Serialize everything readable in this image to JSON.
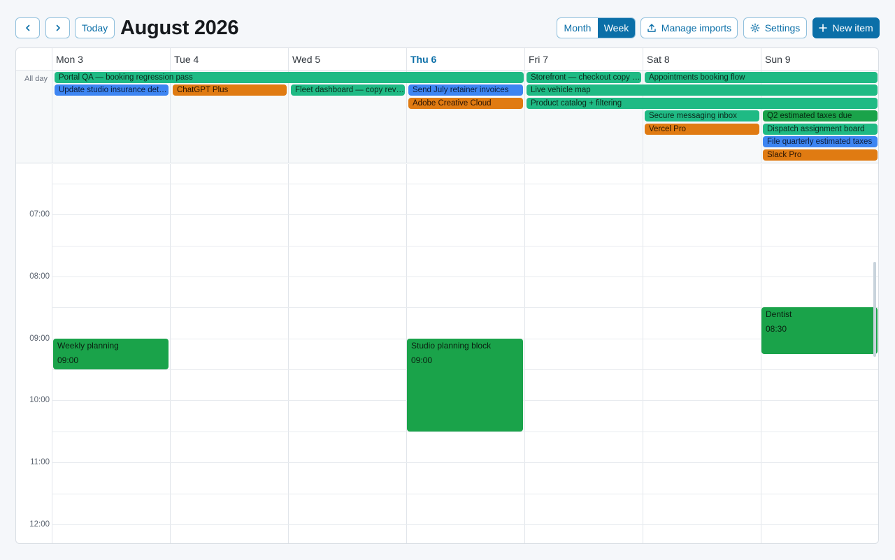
{
  "toolbar": {
    "prev_icon": "chevron-left-icon",
    "next_icon": "chevron-right-icon",
    "today_label": "Today",
    "title": "August 2026",
    "view_month": "Month",
    "view_week": "Week",
    "active_view": "Week",
    "manage_imports_label": "Manage imports",
    "settings_label": "Settings",
    "new_item_label": "New item"
  },
  "days": [
    {
      "label": "Mon 3",
      "today": false
    },
    {
      "label": "Tue 4",
      "today": false
    },
    {
      "label": "Wed 5",
      "today": false
    },
    {
      "label": "Thu 6",
      "today": true
    },
    {
      "label": "Fri 7",
      "today": false
    },
    {
      "label": "Sat 8",
      "today": false
    },
    {
      "label": "Sun 9",
      "today": false
    }
  ],
  "all_day_label": "All day",
  "all_day_events": [
    {
      "title": "Portal QA — booking regression pass",
      "color": "teal"
    },
    {
      "title": "Storefront — checkout copy review",
      "color": "teal"
    },
    {
      "title": "Appointments booking flow",
      "color": "teal"
    },
    {
      "title": "Update studio insurance details",
      "color": "blue"
    },
    {
      "title": "ChatGPT Plus",
      "color": "orange"
    },
    {
      "title": "Fleet dashboard — copy review",
      "color": "teal"
    },
    {
      "title": "Send July retainer invoices",
      "color": "blue"
    },
    {
      "title": "Live vehicle map",
      "color": "teal"
    },
    {
      "title": "Adobe Creative Cloud",
      "color": "orange"
    },
    {
      "title": "Product catalog + filtering",
      "color": "teal"
    },
    {
      "title": "Secure messaging inbox",
      "color": "teal"
    },
    {
      "title": "Q2 estimated taxes due",
      "color": "green"
    },
    {
      "title": "Vercel Pro",
      "color": "orange"
    },
    {
      "title": "Dispatch assignment board",
      "color": "teal"
    },
    {
      "title": "File quarterly estimated taxes",
      "color": "blue"
    },
    {
      "title": "Slack Pro",
      "color": "orange"
    }
  ],
  "time_labels": [
    "07:00",
    "08:00",
    "09:00",
    "10:00",
    "11:00",
    "12:00"
  ],
  "timed_events": [
    {
      "title": "Weekly planning",
      "time": "09:00",
      "day": "Mon 3"
    },
    {
      "title": "Studio planning block",
      "time": "09:00",
      "day": "Thu 6"
    },
    {
      "title": "Dentist",
      "time": "08:30",
      "day": "Sun 9"
    }
  ],
  "colors": {
    "accent": "#0b6fa8",
    "teal": "#1fba84",
    "blue": "#3d85f2",
    "orange": "#e07b12",
    "green": "#1aa34a"
  }
}
